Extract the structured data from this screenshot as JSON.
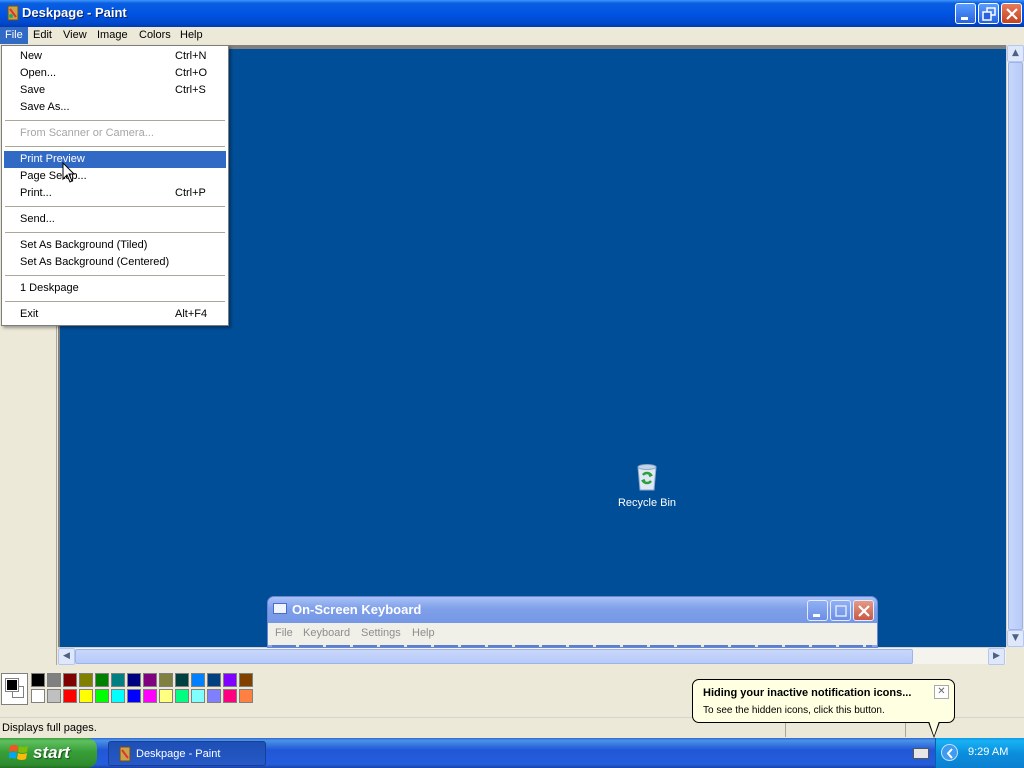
{
  "window": {
    "title": "Deskpage - Paint",
    "icon": "paint-app-icon",
    "controls": [
      "minimize-icon",
      "restore-icon",
      "close-icon"
    ]
  },
  "menubar": {
    "items": [
      "File",
      "Edit",
      "View",
      "Image",
      "Colors",
      "Help"
    ],
    "active": "File"
  },
  "file_menu": {
    "items": [
      {
        "label": "New",
        "shortcut": "Ctrl+N"
      },
      {
        "label": "Open...",
        "shortcut": "Ctrl+O"
      },
      {
        "label": "Save",
        "shortcut": "Ctrl+S"
      },
      {
        "label": "Save As...",
        "shortcut": ""
      },
      {
        "label": "From Scanner or Camera...",
        "shortcut": "",
        "disabled": true
      },
      {
        "label": "Print Preview",
        "shortcut": "",
        "highlighted": true
      },
      {
        "label": "Page Setup...",
        "shortcut": ""
      },
      {
        "label": "Print...",
        "shortcut": "Ctrl+P"
      },
      {
        "label": "Send...",
        "shortcut": ""
      },
      {
        "label": "Set As Background (Tiled)",
        "shortcut": ""
      },
      {
        "label": "Set As Background (Centered)",
        "shortcut": ""
      },
      {
        "label": "1 Deskpage",
        "shortcut": ""
      },
      {
        "label": "Exit",
        "shortcut": "Alt+F4"
      }
    ]
  },
  "canvas": {
    "background_color": "#004e98",
    "desktop_icon": {
      "label": "Recycle Bin",
      "icon": "recycle-bin-icon"
    }
  },
  "palette": {
    "foreground": "#000000",
    "background": "#ffffff",
    "colors_top": [
      "#000000",
      "#808080",
      "#800000",
      "#808000",
      "#008000",
      "#008080",
      "#000080",
      "#800080",
      "#808040",
      "#004040",
      "#0080ff",
      "#004080",
      "#8000ff",
      "#804000"
    ],
    "colors_bottom": [
      "#ffffff",
      "#c0c0c0",
      "#ff0000",
      "#ffff00",
      "#00ff00",
      "#00ffff",
      "#0000ff",
      "#ff00ff",
      "#ffff80",
      "#00ff80",
      "#80ffff",
      "#8080ff",
      "#ff0080",
      "#ff8040"
    ]
  },
  "statusbar": {
    "text": "Displays full pages."
  },
  "osk": {
    "title": "On-Screen Keyboard",
    "menu": [
      "File",
      "Keyboard",
      "Settings",
      "Help"
    ]
  },
  "balloon": {
    "title": "Hiding your inactive notification icons...",
    "body": "To see the hidden icons, click this button.",
    "close": "✕"
  },
  "taskbar": {
    "start_label": "start",
    "task_label": "Deskpage - Paint",
    "clock": "9:29 AM"
  }
}
